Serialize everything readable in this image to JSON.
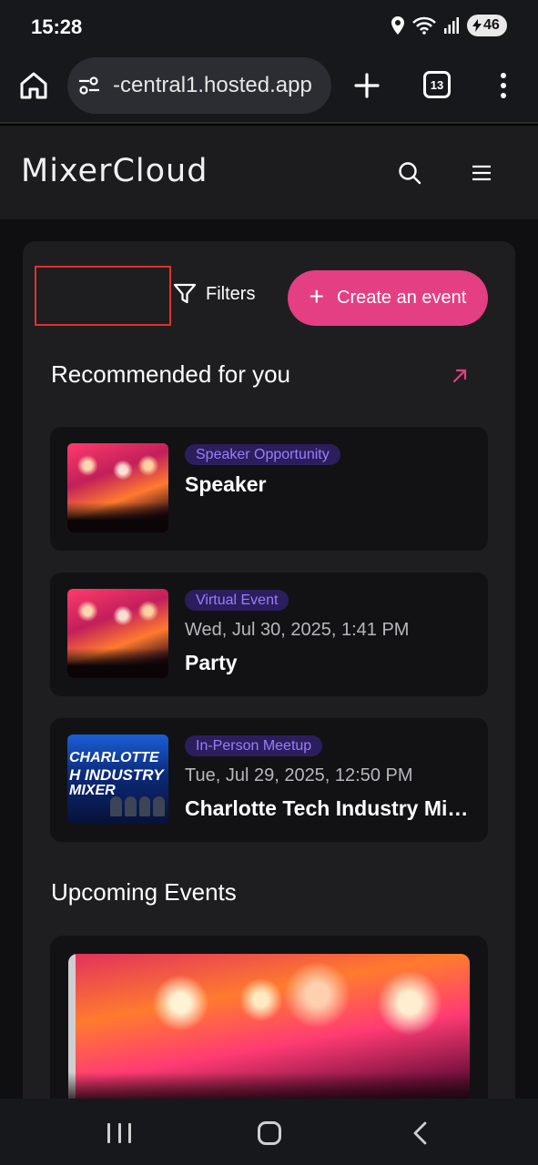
{
  "status_bar": {
    "time": "15:28",
    "battery": "46",
    "icons": [
      "location-icon",
      "wifi-icon",
      "signal-icon",
      "battery-charging-icon"
    ]
  },
  "browser": {
    "url": "-central1.hosted.app",
    "tab_count": "13",
    "icons": [
      "home-icon",
      "site-settings-icon",
      "new-tab-icon",
      "tabs-icon",
      "more-icon"
    ]
  },
  "app": {
    "logo": "MixerCloud",
    "header_icons": [
      "search-icon",
      "menu-icon"
    ]
  },
  "toolbar": {
    "filters_label": "Filters",
    "create_label": "Create an event"
  },
  "recommended": {
    "title": "Recommended for you",
    "events": [
      {
        "tag": "Speaker Opportunity",
        "date": "",
        "name": "Speaker",
        "image": "concert-photo"
      },
      {
        "tag": "Virtual Event",
        "date": "Wed, Jul 30, 2025, 1:41 PM",
        "name": "Party",
        "image": "concert-photo"
      },
      {
        "tag": "In-Person Meetup",
        "date": "Tue, Jul 29, 2025, 12:50 PM",
        "name": "Charlotte Tech Industry Mixer",
        "image": "tech-mixer-flyer"
      }
    ]
  },
  "flyer": {
    "line1": "CHARLOTTE",
    "line2": "H INDUSTRY",
    "line3": "MIXER"
  },
  "upcoming": {
    "title": "Upcoming Events"
  },
  "colors": {
    "accent": "#e43f82",
    "tag_bg": "#2c1e5c",
    "tag_text": "#9b7cff",
    "highlight": "#e0312f"
  }
}
